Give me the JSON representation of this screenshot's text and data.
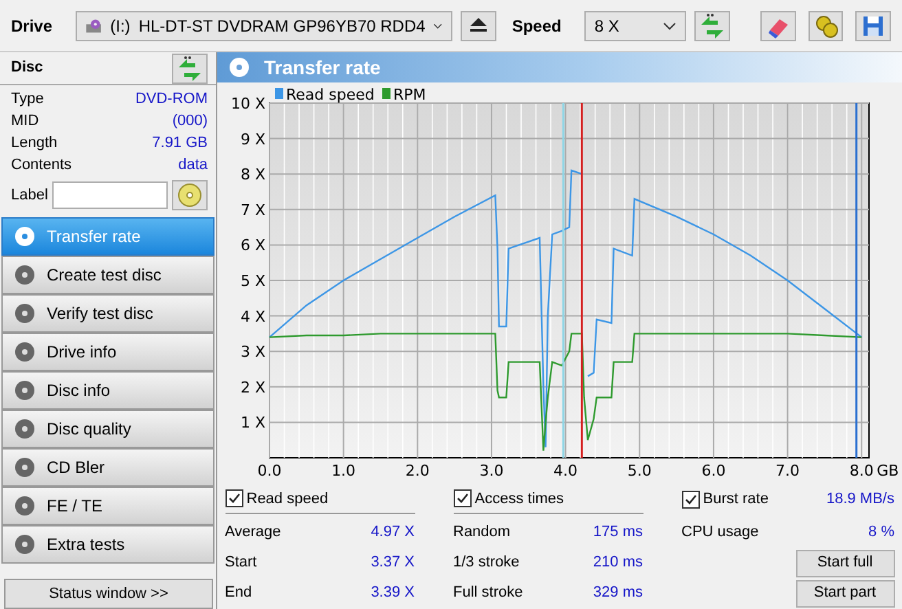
{
  "toolbar": {
    "drive_label": "Drive",
    "drive_letter": "(I:)",
    "drive_name": "HL-DT-ST DVDRAM GP96YB70 RDD4",
    "speed_label": "Speed",
    "speed": "8 X"
  },
  "disc": {
    "title": "Disc",
    "fields": [
      {
        "label": "Type",
        "value": "DVD-ROM"
      },
      {
        "label": "MID",
        "value": "(000)"
      },
      {
        "label": "Length",
        "value": "7.91 GB"
      },
      {
        "label": "Contents",
        "value": "data"
      }
    ],
    "label_field": "Label"
  },
  "nav": [
    {
      "label": "Transfer rate",
      "selected": true
    },
    {
      "label": "Create test disc",
      "selected": false
    },
    {
      "label": "Verify test disc",
      "selected": false
    },
    {
      "label": "Drive info",
      "selected": false
    },
    {
      "label": "Disc info",
      "selected": false
    },
    {
      "label": "Disc quality",
      "selected": false
    },
    {
      "label": "CD Bler",
      "selected": false
    },
    {
      "label": "FE / TE",
      "selected": false
    },
    {
      "label": "Extra tests",
      "selected": false
    }
  ],
  "status_button": "Status window >>",
  "panel": {
    "title": "Transfer rate",
    "chart_data": {
      "type": "line",
      "xlabel": "GB",
      "xlim": [
        0,
        8.1
      ],
      "ylim": [
        0,
        10
      ],
      "xticks": [
        {
          "value": 0,
          "label": "0.0"
        },
        {
          "value": 1,
          "label": "1.0"
        },
        {
          "value": 2,
          "label": "2.0"
        },
        {
          "value": 3,
          "label": "3.0"
        },
        {
          "value": 4,
          "label": "4.0"
        },
        {
          "value": 5,
          "label": "5.0"
        },
        {
          "value": 6,
          "label": "6.0"
        },
        {
          "value": 7,
          "label": "7.0"
        },
        {
          "value": 8,
          "label": "8.0"
        }
      ],
      "yticks": [
        {
          "value": 1,
          "label": "1 X"
        },
        {
          "value": 2,
          "label": "2 X"
        },
        {
          "value": 3,
          "label": "3 X"
        },
        {
          "value": 4,
          "label": "4 X"
        },
        {
          "value": 5,
          "label": "5 X"
        },
        {
          "value": 6,
          "label": "6 X"
        },
        {
          "value": 7,
          "label": "7 X"
        },
        {
          "value": 8,
          "label": "8 X"
        },
        {
          "value": 9,
          "label": "9 X"
        },
        {
          "value": 10,
          "label": "10 X"
        }
      ],
      "x": [
        0,
        0.5,
        1,
        1.5,
        2,
        2.5,
        3.05,
        3.08,
        3.1,
        3.2,
        3.23,
        3.65,
        3.7,
        3.73,
        3.76,
        3.82,
        3.95,
        4.05,
        4.08,
        4.22,
        4.25,
        4.3,
        4.38,
        4.42,
        4.62,
        4.65,
        4.9,
        4.93,
        5.5,
        6,
        6.5,
        7,
        7.5,
        8
      ],
      "series": [
        {
          "name": "Read speed",
          "color": "#3c96e6",
          "values": [
            3.4,
            4.3,
            5.0,
            5.6,
            6.2,
            6.8,
            7.4,
            5.9,
            3.7,
            3.7,
            5.9,
            6.2,
            2.0,
            0.3,
            4.0,
            6.3,
            6.4,
            6.5,
            8.1,
            8.0,
            null,
            2.3,
            2.4,
            3.9,
            3.8,
            5.9,
            5.7,
            7.3,
            6.8,
            6.3,
            5.7,
            5.0,
            4.2,
            3.4
          ]
        },
        {
          "name": "RPM",
          "color": "#2e9a2e",
          "values": [
            3.4,
            3.45,
            3.45,
            3.5,
            3.5,
            3.5,
            3.5,
            1.9,
            1.7,
            1.7,
            2.7,
            2.7,
            0.2,
            1.0,
            1.7,
            2.7,
            2.6,
            3.0,
            3.5,
            3.5,
            1.7,
            0.5,
            1.1,
            1.7,
            1.7,
            2.7,
            2.7,
            3.5,
            3.5,
            3.5,
            3.5,
            3.5,
            3.45,
            3.4
          ]
        }
      ],
      "grid": true,
      "legend": true,
      "ref_lines": [
        {
          "axis": "x",
          "value": 3.97,
          "color": "#8fd6e6"
        },
        {
          "axis": "x",
          "value": 4.22,
          "color": "#d42020"
        },
        {
          "axis": "x",
          "value": 7.93,
          "color": "#2a6fd0"
        }
      ]
    }
  },
  "stats": [
    {
      "label": "Read speed",
      "checked": true,
      "rows": [
        {
          "label": "Average",
          "value": "4.97 X"
        },
        {
          "label": "Start",
          "value": "3.37 X"
        },
        {
          "label": "End",
          "value": "3.39 X"
        }
      ]
    },
    {
      "label": "Access times",
      "checked": true,
      "rows": [
        {
          "label": "Random",
          "value": "175 ms"
        },
        {
          "label": "1/3 stroke",
          "value": "210 ms"
        },
        {
          "label": "Full stroke",
          "value": "329 ms"
        }
      ]
    }
  ],
  "burst": {
    "label": "Burst rate",
    "checked": true,
    "value": "18.9 MB/s"
  },
  "cpu": {
    "label": "CPU usage",
    "value": "8 %"
  },
  "buttons": [
    "Start full",
    "Start part"
  ]
}
